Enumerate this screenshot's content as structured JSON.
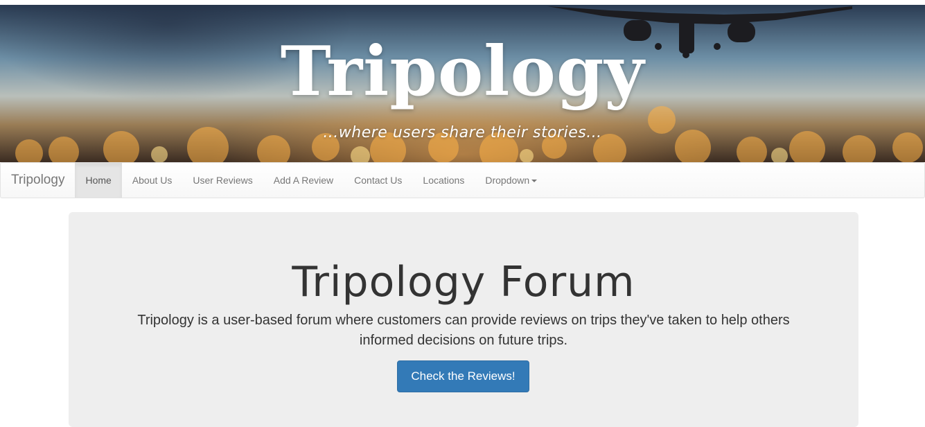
{
  "header": {
    "title": "Tripology",
    "tagline": "...where users share their stories..."
  },
  "navbar": {
    "brand": "Tripology",
    "items": [
      {
        "label": "Home",
        "active": true
      },
      {
        "label": "About Us"
      },
      {
        "label": "User Reviews"
      },
      {
        "label": "Add A Review"
      },
      {
        "label": "Contact Us"
      },
      {
        "label": "Locations"
      },
      {
        "label": "Dropdown"
      }
    ]
  },
  "jumbotron": {
    "title": "Tripology Forum",
    "text": "Tripology is a user-based forum where customers can provide reviews on trips they've taken to help others informed decisions on future trips.",
    "button_label": "Check the Reviews!"
  },
  "colors": {
    "primary_button": "#337ab7",
    "jumbotron_bg": "#eeeeee",
    "nav_text": "#777777"
  }
}
